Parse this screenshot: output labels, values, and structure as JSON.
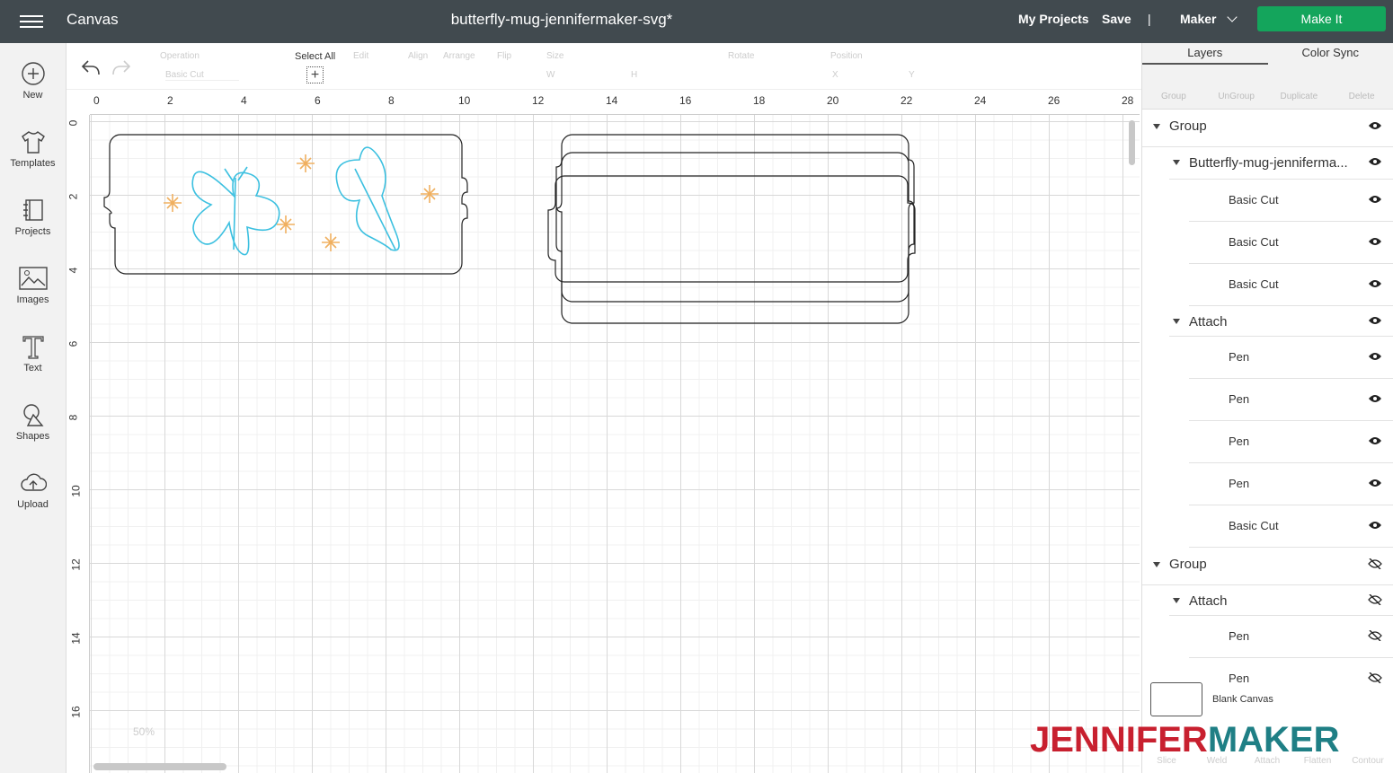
{
  "header": {
    "app": "Canvas",
    "title": "butterfly-mug-jennifermaker-svg*",
    "my_projects": "My Projects",
    "save": "Save",
    "sep": "|",
    "machine": "Maker",
    "make_it": "Make It"
  },
  "sidebar": {
    "items": [
      {
        "label": "New",
        "icon": "plus-circle-icon"
      },
      {
        "label": "Templates",
        "icon": "shirt-icon"
      },
      {
        "label": "Projects",
        "icon": "book-icon"
      },
      {
        "label": "Images",
        "icon": "image-icon"
      },
      {
        "label": "Text",
        "icon": "text-icon"
      },
      {
        "label": "Shapes",
        "icon": "shapes-icon"
      },
      {
        "label": "Upload",
        "icon": "cloud-upload-icon"
      }
    ]
  },
  "toolbar": {
    "operation": "Operation",
    "operation_value": "Basic Cut",
    "select_all": "Select All",
    "edit": "Edit",
    "align": "Align",
    "arrange": "Arrange",
    "flip": "Flip",
    "size": "Size",
    "size_w": "W",
    "size_h": "H",
    "rotate": "Rotate",
    "position": "Position",
    "pos_x": "X",
    "pos_y": "Y"
  },
  "rulers": {
    "h": [
      "0",
      "2",
      "4",
      "6",
      "8",
      "10",
      "12",
      "14",
      "16",
      "18",
      "20",
      "22",
      "24",
      "26",
      "28"
    ],
    "v": [
      "0",
      "2",
      "4",
      "6",
      "8",
      "10",
      "12",
      "14",
      "16"
    ]
  },
  "zoom": "50%",
  "panel": {
    "tabs": [
      "Layers",
      "Color Sync"
    ],
    "tools": [
      "Group",
      "UnGroup",
      "Duplicate",
      "Delete"
    ],
    "layers": [
      {
        "label": "Group",
        "level": 0,
        "expand": true,
        "visible": true
      },
      {
        "label": "Butterfly-mug-jenniferma...",
        "level": 1,
        "expand": true,
        "visible": true
      },
      {
        "label": "Basic Cut",
        "level": 2,
        "visible": true
      },
      {
        "label": "Basic Cut",
        "level": 2,
        "visible": true
      },
      {
        "label": "Basic Cut",
        "level": 2,
        "visible": true
      },
      {
        "label": "Attach",
        "level": 1,
        "expand": true,
        "visible": true
      },
      {
        "label": "Pen",
        "level": 2,
        "visible": true
      },
      {
        "label": "Pen",
        "level": 2,
        "visible": true
      },
      {
        "label": "Pen",
        "level": 2,
        "visible": true
      },
      {
        "label": "Pen",
        "level": 2,
        "visible": true
      },
      {
        "label": "Basic Cut",
        "level": 2,
        "visible": true
      },
      {
        "label": "Group",
        "level": 0,
        "expand": true,
        "visible": false
      },
      {
        "label": "Attach",
        "level": 1,
        "expand": true,
        "visible": false
      },
      {
        "label": "Pen",
        "level": 2,
        "visible": false
      },
      {
        "label": "Pen",
        "level": 2,
        "visible": false
      }
    ],
    "blank_canvas": "Blank Canvas",
    "bottom_tools": [
      "Slice",
      "Weld",
      "Attach",
      "Flatten",
      "Contour"
    ]
  },
  "watermark": {
    "part1": "JENNIFER",
    "part2": "MAKER"
  },
  "colors": {
    "topbar": "#414a4f",
    "make_it": "#14a55c",
    "butterfly": "#3cc0e0",
    "flower": "#f0b060",
    "logo_red": "#c8202f",
    "logo_teal": "#1f7f85"
  }
}
